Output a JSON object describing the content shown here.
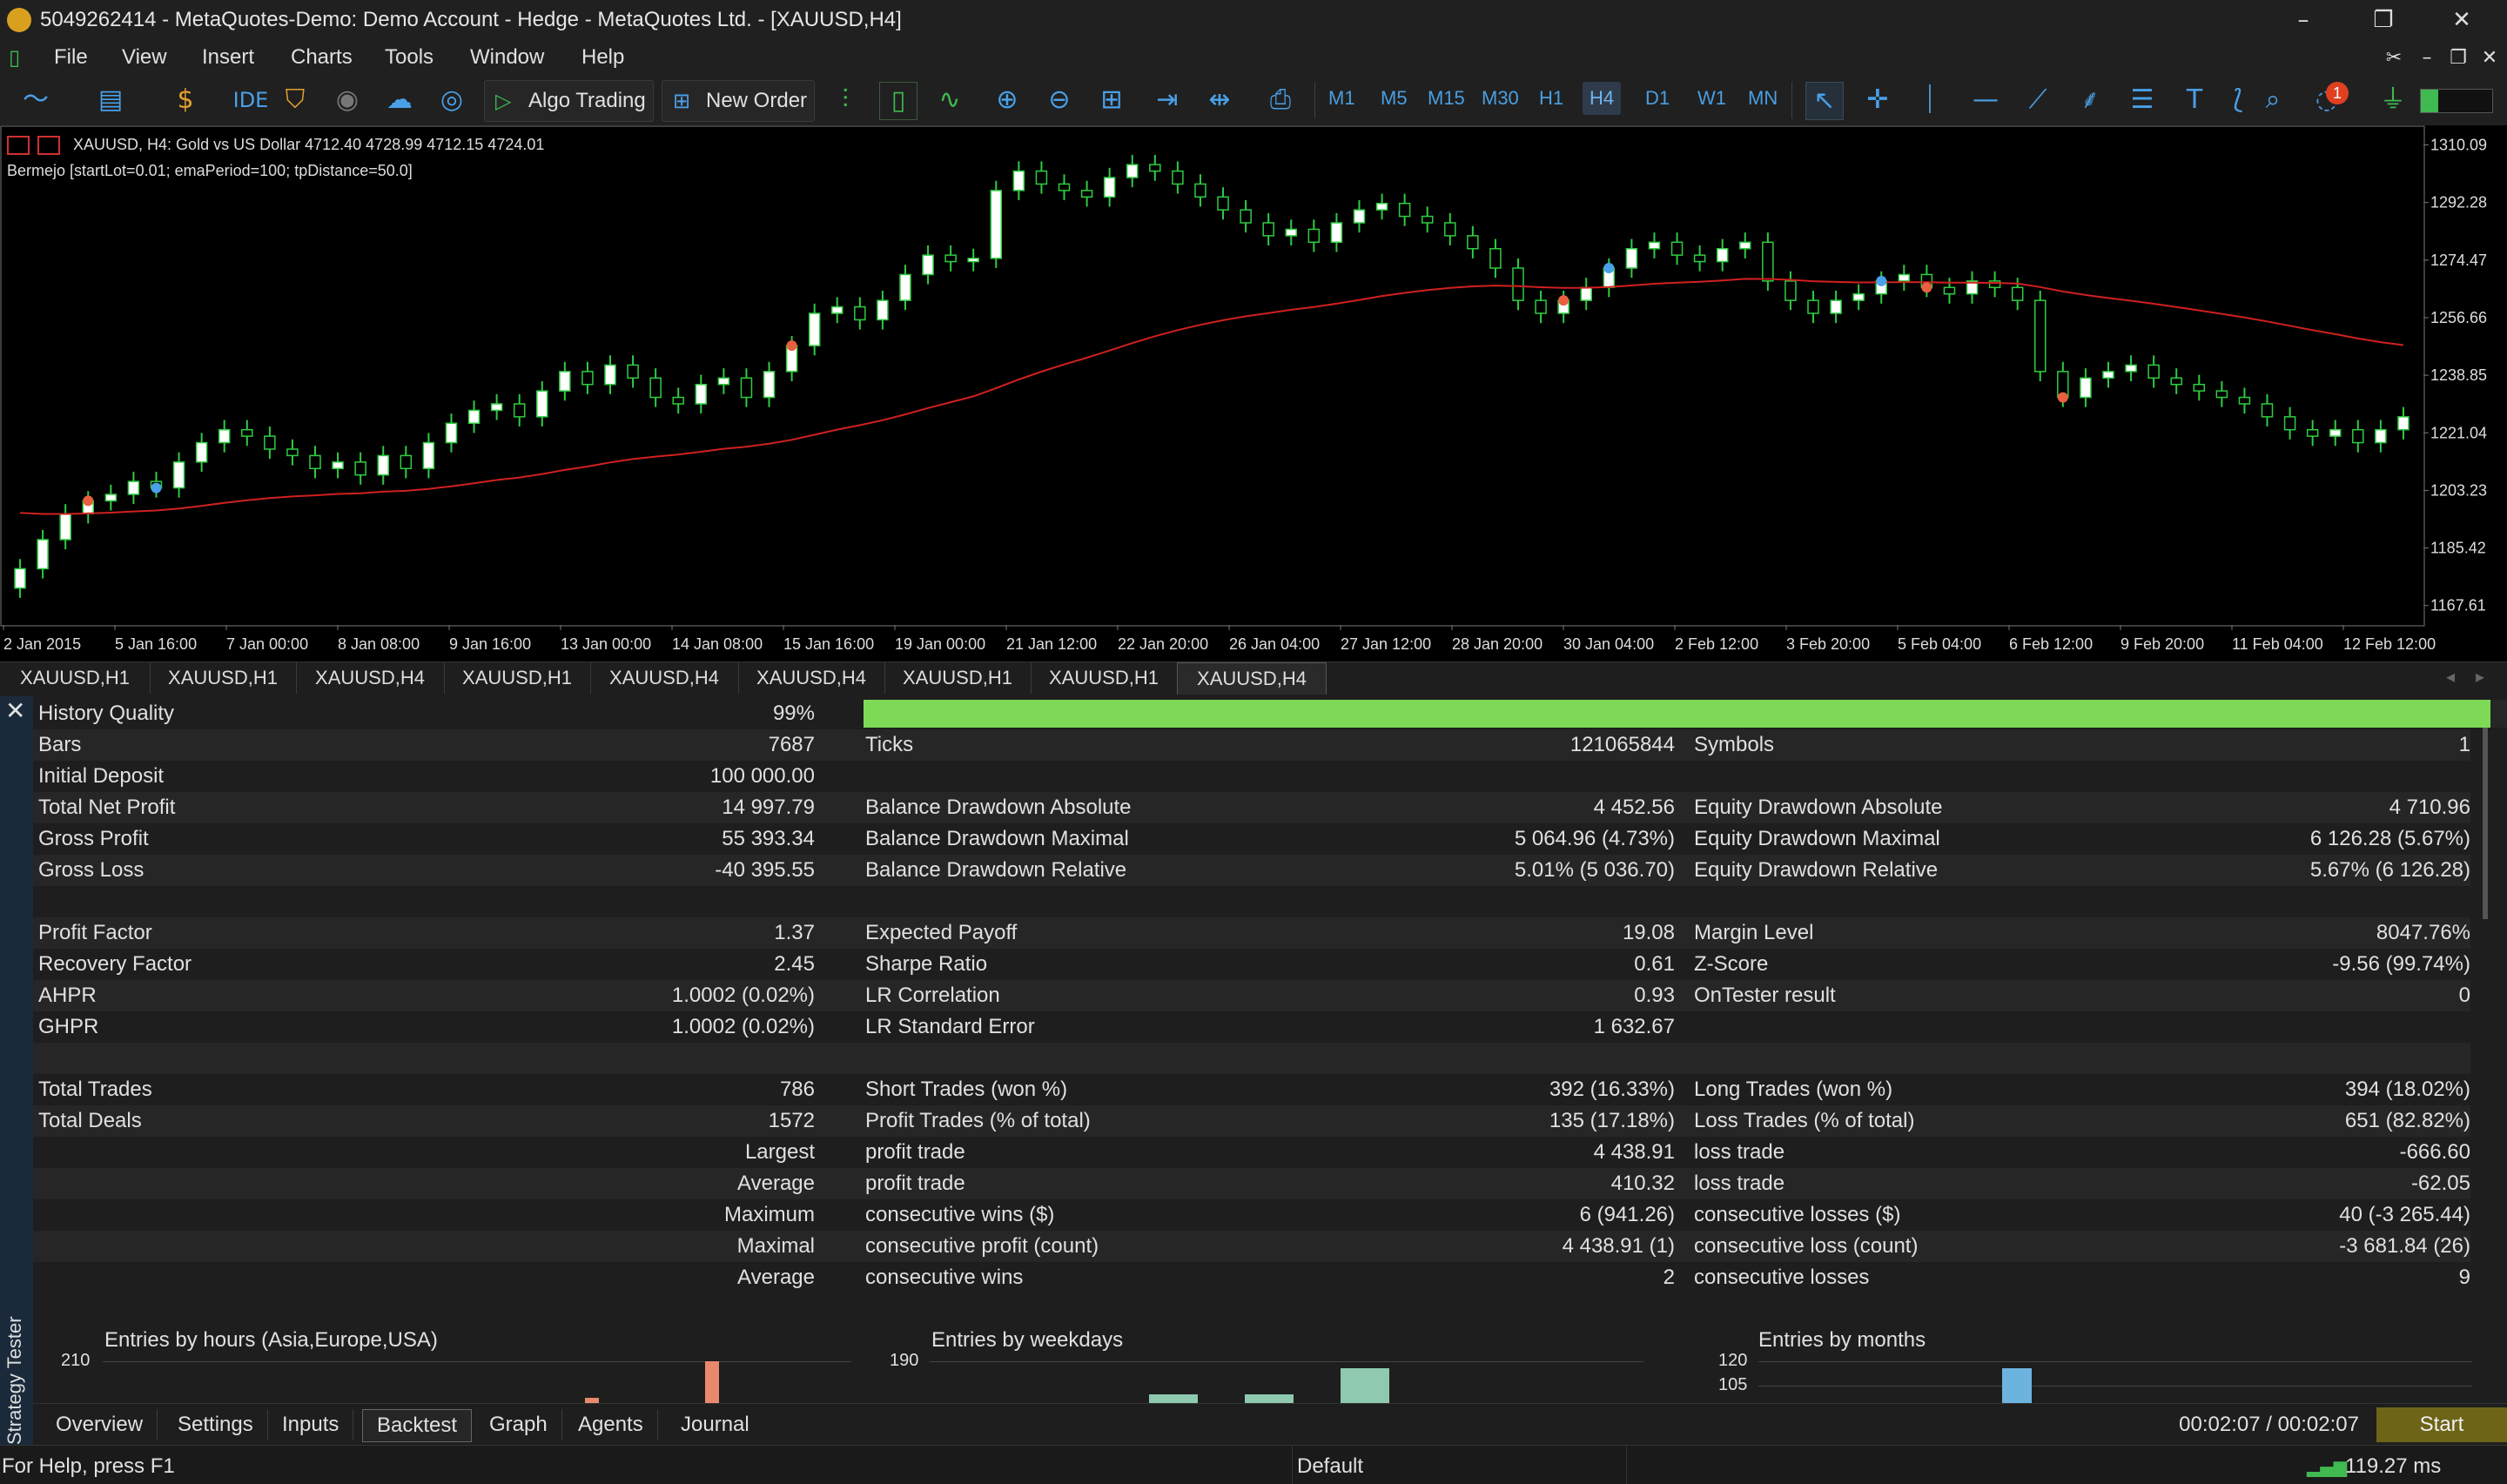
{
  "window": {
    "title": "5049262414 - MetaQuotes-Demo: Demo Account - Hedge - MetaQuotes Ltd. - [XAUUSD,H4]"
  },
  "menu": [
    "File",
    "View",
    "Insert",
    "Charts",
    "Tools",
    "Window",
    "Help"
  ],
  "toolbar": {
    "ide_label": "IDE",
    "algo_trading_label": "Algo Trading",
    "new_order_label": "New Order",
    "timeframes": [
      "M1",
      "M5",
      "M15",
      "M30",
      "H1",
      "H4",
      "D1",
      "W1",
      "MN"
    ],
    "active_timeframe": "H4",
    "notification_count": "1"
  },
  "chart": {
    "info_line": "XAUUSD, H4:  Gold vs US Dollar  4712.40 4728.99 4712.15 4724.01",
    "indicator_line": "Bermejo [startLot=0.01; emaPeriod=100; tpDistance=50.0]",
    "price_labels": [
      "1310.09",
      "1292.28",
      "1274.47",
      "1256.66",
      "1238.85",
      "1221.04",
      "1203.23",
      "1185.42",
      "1167.61"
    ],
    "time_labels": [
      "2 Jan 2015",
      "5 Jan 16:00",
      "7 Jan 00:00",
      "8 Jan 08:00",
      "9 Jan 16:00",
      "13 Jan 00:00",
      "14 Jan 08:00",
      "15 Jan 16:00",
      "19 Jan 00:00",
      "21 Jan 12:00",
      "22 Jan 20:00",
      "26 Jan 04:00",
      "27 Jan 12:00",
      "28 Jan 20:00",
      "30 Jan 04:00",
      "2 Feb 12:00",
      "3 Feb 20:00",
      "5 Feb 04:00",
      "6 Feb 12:00",
      "9 Feb 20:00",
      "11 Feb 04:00",
      "12 Feb 12:00"
    ],
    "candle_closes": [
      1179,
      1188,
      1196,
      1200,
      1202,
      1206,
      1204,
      1212,
      1218,
      1222,
      1220,
      1216,
      1214,
      1210,
      1212,
      1208,
      1214,
      1210,
      1218,
      1224,
      1228,
      1230,
      1226,
      1234,
      1240,
      1236,
      1242,
      1238,
      1232,
      1230,
      1236,
      1238,
      1232,
      1240,
      1248,
      1258,
      1260,
      1256,
      1262,
      1270,
      1276,
      1274,
      1275,
      1296,
      1302,
      1298,
      1296,
      1294,
      1300,
      1304,
      1302,
      1298,
      1294,
      1290,
      1286,
      1282,
      1284,
      1280,
      1286,
      1290,
      1292,
      1288,
      1286,
      1282,
      1278,
      1272,
      1262,
      1258,
      1262,
      1266,
      1272,
      1278,
      1280,
      1276,
      1274,
      1278,
      1280,
      1268,
      1262,
      1258,
      1262,
      1264,
      1268,
      1270,
      1266,
      1264,
      1268,
      1266,
      1262,
      1240,
      1232,
      1238,
      1240,
      1242,
      1238,
      1236,
      1234,
      1232,
      1230,
      1226,
      1222,
      1220,
      1222,
      1218,
      1222,
      1226
    ]
  },
  "chart_tabs": [
    "XAUUSD,H1",
    "XAUUSD,H1",
    "XAUUSD,H4",
    "XAUUSD,H1",
    "XAUUSD,H4",
    "XAUUSD,H4",
    "XAUUSD,H1",
    "XAUUSD,H1",
    "XAUUSD,H4"
  ],
  "report": {
    "history_quality_label": "History Quality",
    "history_quality_value": "99%",
    "history_quality_fraction": 0.99,
    "col1": [
      {
        "label": "Bars",
        "value": "7687"
      },
      {
        "label": "Initial Deposit",
        "value": "100 000.00"
      },
      {
        "label": "Total Net Profit",
        "value": "14 997.79"
      },
      {
        "label": "Gross Profit",
        "value": "55 393.34"
      },
      {
        "label": "Gross Loss",
        "value": "-40 395.55"
      },
      {
        "label": "",
        "value": ""
      },
      {
        "label": "Profit Factor",
        "value": "1.37"
      },
      {
        "label": "Recovery Factor",
        "value": "2.45"
      },
      {
        "label": "AHPR",
        "value": "1.0002 (0.02%)"
      },
      {
        "label": "GHPR",
        "value": "1.0002 (0.02%)"
      },
      {
        "label": "",
        "value": ""
      },
      {
        "label": "Total Trades",
        "value": "786"
      },
      {
        "label": "Total Deals",
        "value": "1572"
      },
      {
        "label": "",
        "value": "Largest"
      },
      {
        "label": "",
        "value": "Average"
      },
      {
        "label": "",
        "value": "Maximum"
      },
      {
        "label": "",
        "value": "Maximal"
      },
      {
        "label": "",
        "value": "Average"
      }
    ],
    "col2": [
      {
        "label": "Ticks",
        "value": "121065844"
      },
      {
        "label": "",
        "value": ""
      },
      {
        "label": "Balance Drawdown Absolute",
        "value": "4 452.56"
      },
      {
        "label": "Balance Drawdown Maximal",
        "value": "5 064.96 (4.73%)"
      },
      {
        "label": "Balance Drawdown Relative",
        "value": "5.01% (5 036.70)"
      },
      {
        "label": "",
        "value": ""
      },
      {
        "label": "Expected Payoff",
        "value": "19.08"
      },
      {
        "label": "Sharpe Ratio",
        "value": "0.61"
      },
      {
        "label": "LR Correlation",
        "value": "0.93"
      },
      {
        "label": "LR Standard Error",
        "value": "1 632.67"
      },
      {
        "label": "",
        "value": ""
      },
      {
        "label": "Short Trades (won %)",
        "value": "392 (16.33%)"
      },
      {
        "label": "Profit Trades (% of total)",
        "value": "135 (17.18%)"
      },
      {
        "label": "profit trade",
        "value": "4 438.91"
      },
      {
        "label": "profit trade",
        "value": "410.32"
      },
      {
        "label": "consecutive wins ($)",
        "value": "6 (941.26)"
      },
      {
        "label": "consecutive profit (count)",
        "value": "4 438.91 (1)"
      },
      {
        "label": "consecutive wins",
        "value": "2"
      }
    ],
    "col3": [
      {
        "label": "Symbols",
        "value": "1"
      },
      {
        "label": "",
        "value": ""
      },
      {
        "label": "Equity Drawdown Absolute",
        "value": "4 710.96"
      },
      {
        "label": "Equity Drawdown Maximal",
        "value": "6 126.28 (5.67%)"
      },
      {
        "label": "Equity Drawdown Relative",
        "value": "5.67% (6 126.28)"
      },
      {
        "label": "",
        "value": ""
      },
      {
        "label": "Margin Level",
        "value": "8047.76%"
      },
      {
        "label": "Z-Score",
        "value": "-9.56 (99.74%)"
      },
      {
        "label": "OnTester result",
        "value": "0"
      },
      {
        "label": "",
        "value": ""
      },
      {
        "label": "",
        "value": ""
      },
      {
        "label": "Long Trades (won %)",
        "value": "394 (18.02%)"
      },
      {
        "label": "Loss Trades (% of total)",
        "value": "651 (82.82%)"
      },
      {
        "label": "loss trade",
        "value": "-666.60"
      },
      {
        "label": "loss trade",
        "value": "-62.05"
      },
      {
        "label": "consecutive losses ($)",
        "value": "40 (-3 265.44)"
      },
      {
        "label": "consecutive loss (count)",
        "value": "-3 681.84 (26)"
      },
      {
        "label": "consecutive losses",
        "value": "9"
      }
    ],
    "mini_charts": [
      {
        "title": "Entries by hours (Asia,Europe,USA)",
        "tick": "210"
      },
      {
        "title": "Entries by weekdays",
        "tick": "190"
      },
      {
        "title": "Entries by months",
        "tick": "120",
        "tick2": "105"
      }
    ]
  },
  "bottom_tabs": [
    "Overview",
    "Settings",
    "Inputs",
    "Backtest",
    "Graph",
    "Agents",
    "Journal"
  ],
  "active_bottom_tab": "Backtest",
  "timer": "00:02:07 / 00:02:07",
  "start_label": "Start",
  "side_label": "Strategy Tester",
  "status": {
    "help": "For Help, press F1",
    "profile": "Default",
    "ping": "119.27 ms"
  },
  "colors": {
    "bull_candle": "#ffffff",
    "bear_candle": "#000000",
    "candle_outline": "#2ecc40",
    "ema_line": "#d02020",
    "quality_bar": "#7ed957",
    "start_button": "#6d6418"
  }
}
